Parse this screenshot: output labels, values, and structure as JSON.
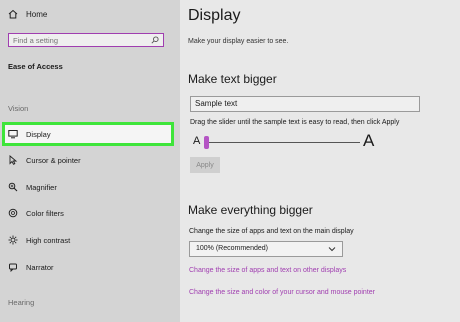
{
  "sidebar": {
    "home_label": "Home",
    "search_placeholder": "Find a setting",
    "section_title": "Ease of Access",
    "group_vision": "Vision",
    "items": [
      {
        "label": "Display",
        "icon": "monitor-icon"
      },
      {
        "label": "Cursor & pointer",
        "icon": "cursor-icon"
      },
      {
        "label": "Magnifier",
        "icon": "magnifier-icon"
      },
      {
        "label": "Color filters",
        "icon": "color-filters-icon"
      },
      {
        "label": "High contrast",
        "icon": "high-contrast-icon"
      },
      {
        "label": "Narrator",
        "icon": "narrator-icon"
      }
    ],
    "group_hearing": "Hearing"
  },
  "main": {
    "title": "Display",
    "subtitle": "Make your display easier to see.",
    "text_section": {
      "heading": "Make text bigger",
      "sample_text": "Sample text",
      "hint": "Drag the slider until the sample text is easy to read, then click Apply",
      "small_a": "A",
      "big_a": "A",
      "slider_value_fraction": 0.0,
      "apply_label": "Apply"
    },
    "everything_section": {
      "heading": "Make everything bigger",
      "label": "Change the size of apps and text on the main display",
      "select_value": "100% (Recommended)",
      "link1": "Change the size of apps and text on other displays",
      "link2": "Change the size and color of your cursor and mouse pointer"
    }
  },
  "colors": {
    "accent": "#a03eb0",
    "highlight": "#3ee53a"
  }
}
